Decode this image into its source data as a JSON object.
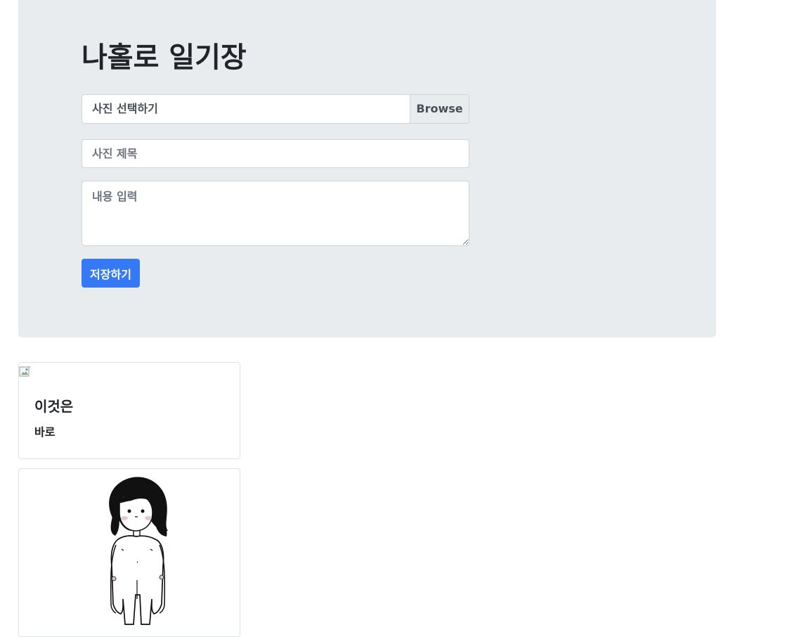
{
  "header": {
    "title": "나홀로 일기장"
  },
  "form": {
    "file_label": "사진 선택하기",
    "browse_label": "Browse",
    "title_placeholder": "사진 제목",
    "content_placeholder": "내용 입력",
    "save_label": "저장하기"
  },
  "posts": [
    {
      "title": "이것은",
      "text": "바로",
      "image_icon": "broken-image-icon"
    },
    {
      "image_icon": "girl-illustration"
    }
  ]
}
